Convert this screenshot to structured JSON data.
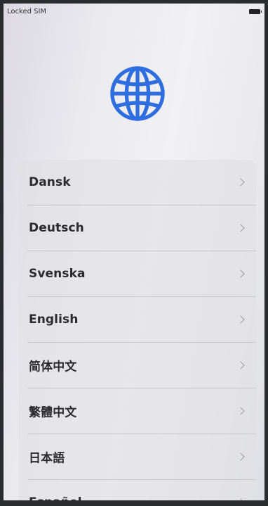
{
  "status_bar": {
    "carrier": "Locked SIM"
  },
  "header": {
    "icon": "globe-icon",
    "accent_color": "#2e6ee0"
  },
  "languages": [
    {
      "label": "Dansk"
    },
    {
      "label": "Deutsch"
    },
    {
      "label": "Svenska"
    },
    {
      "label": "English"
    },
    {
      "label": "简体中文"
    },
    {
      "label": "繁體中文"
    },
    {
      "label": "日本語"
    },
    {
      "label": "Español"
    }
  ]
}
